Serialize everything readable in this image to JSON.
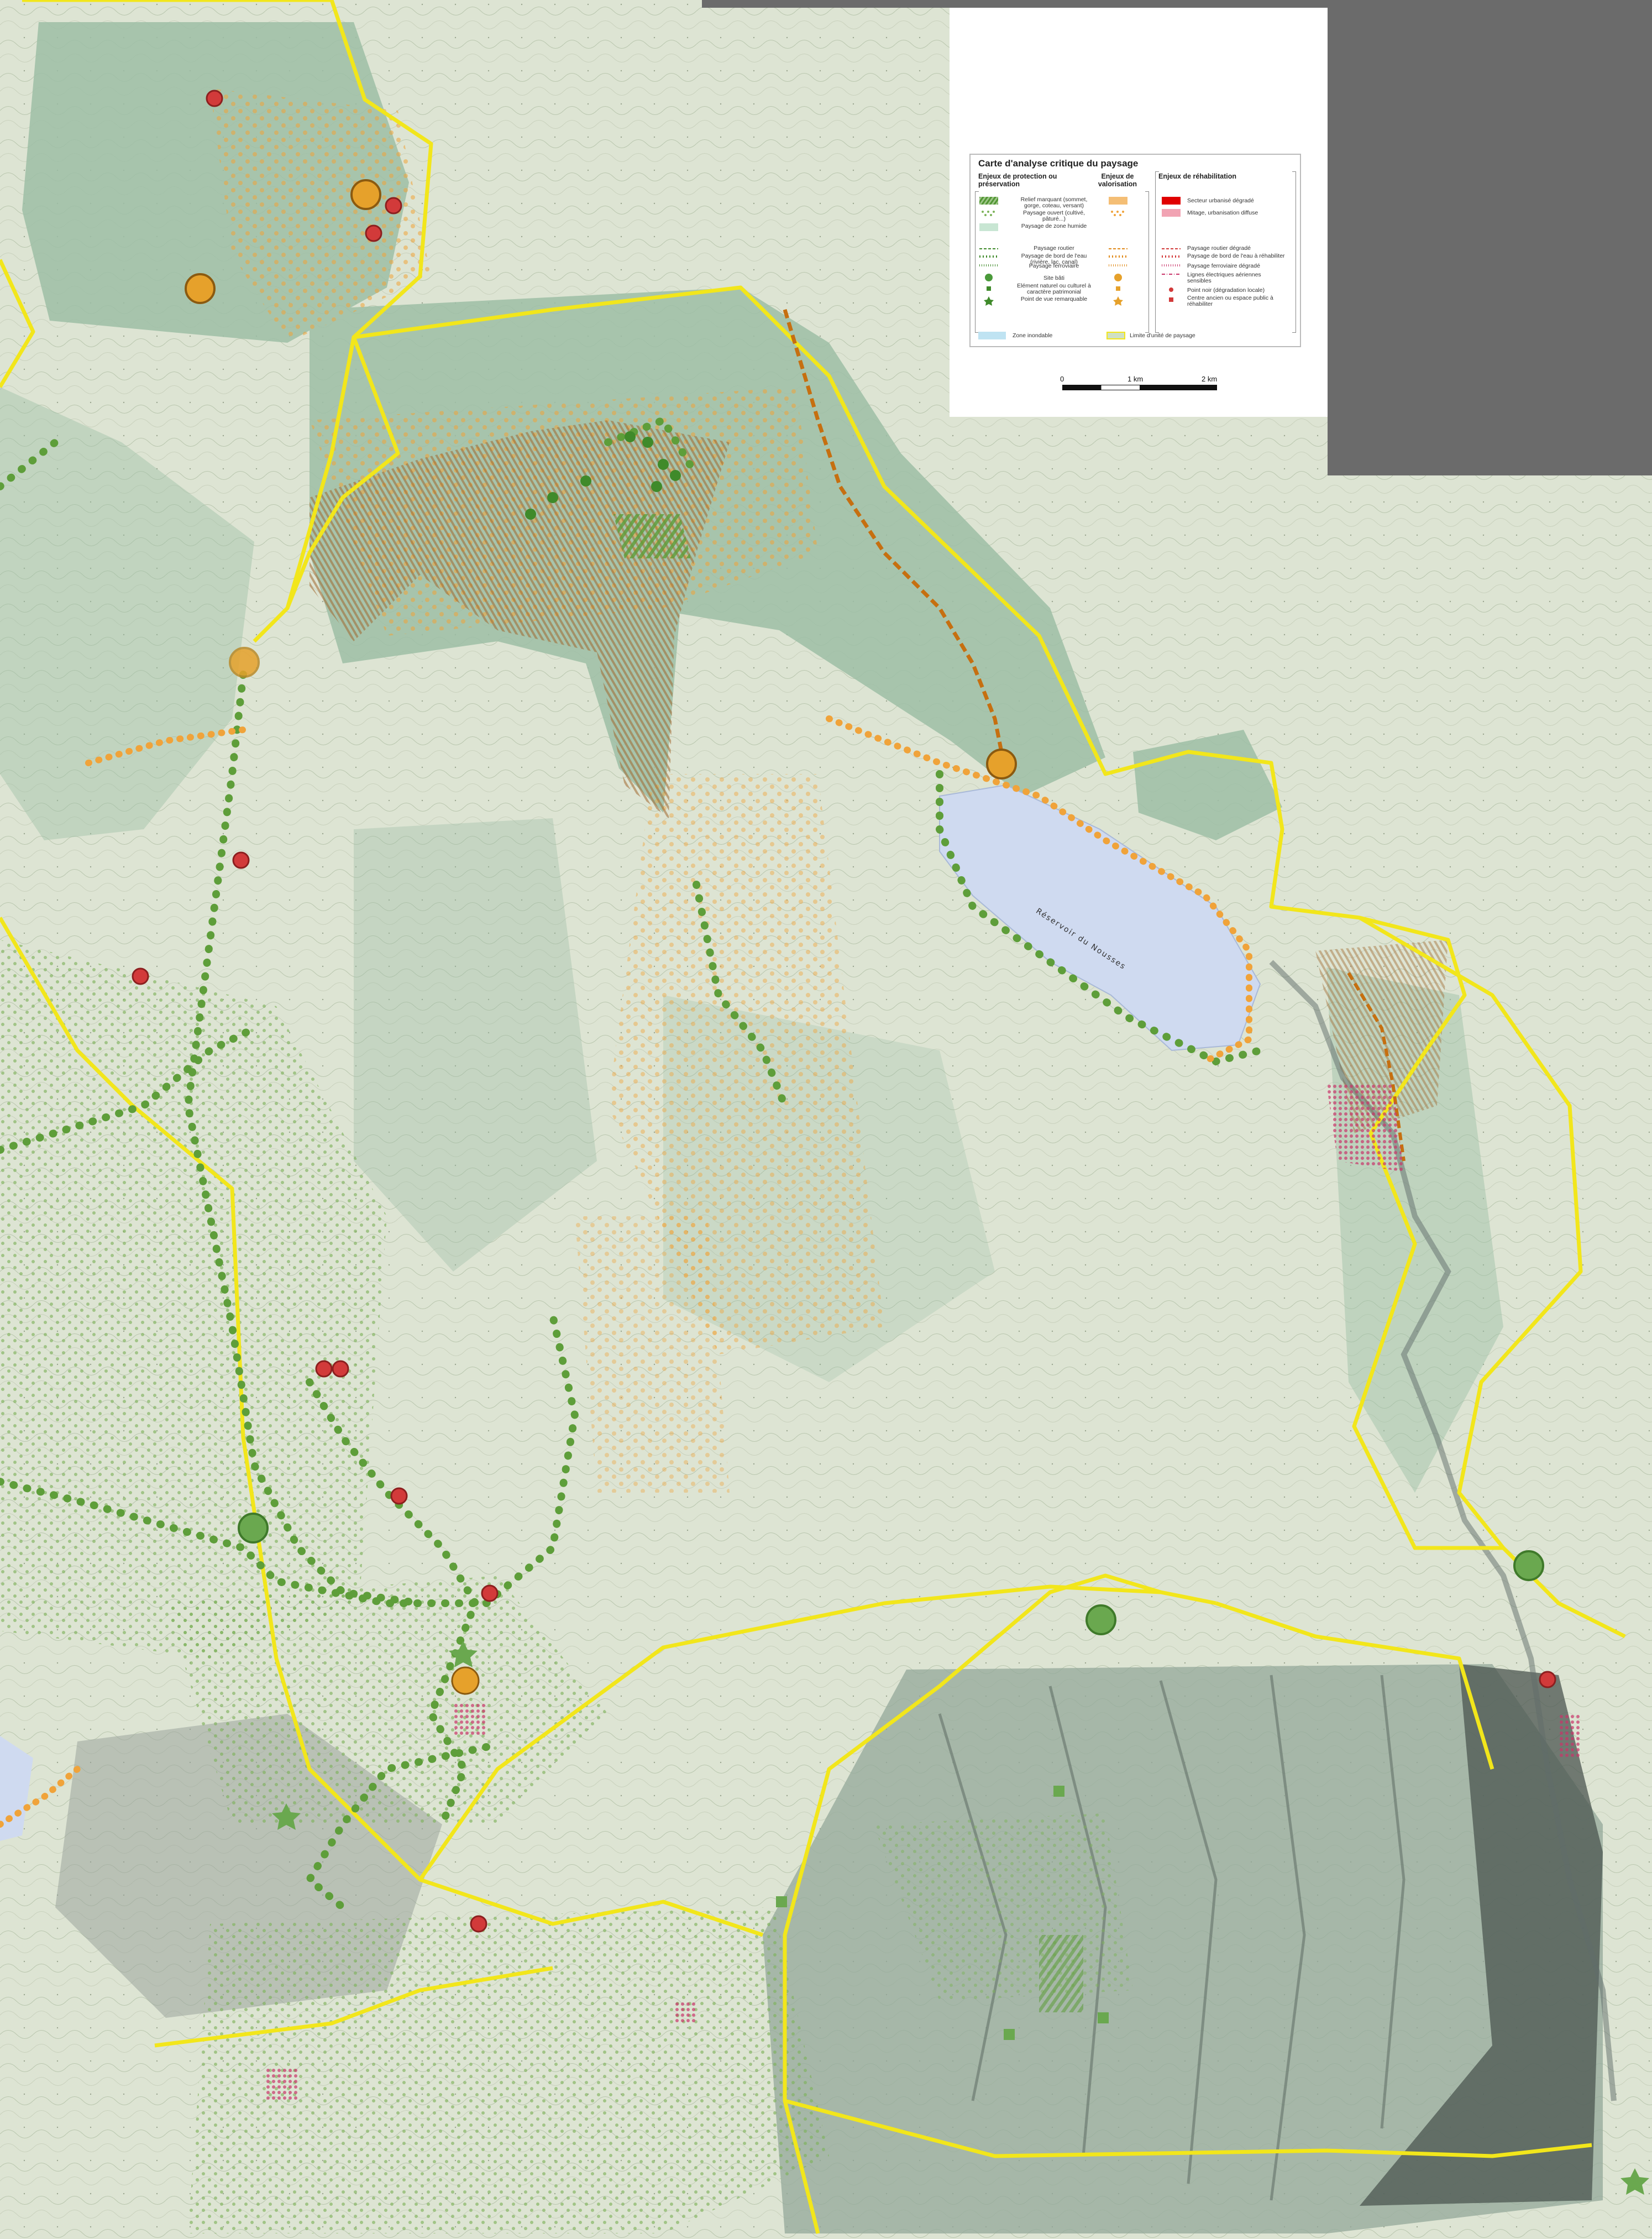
{
  "legend": {
    "title": "Carte d'analyse critique du paysage",
    "col_protection": "Enjeux de protection ou préservation",
    "col_valorisation": "Enjeux de valorisation",
    "col_rehabilitation": "Enjeux de réhabilitation",
    "items_protection": [
      "Relief marquant (sommet, gorge, coteau, versant)",
      "Paysage ouvert (cultivé, pâturé...)",
      "Paysage de zone humide",
      "Paysage routier",
      "Paysage de bord de l'eau (rivière, lac, canal)",
      "Paysage ferroviaire",
      "Site bâti",
      "Elément naturel ou culturel à caractère patrimonial",
      "Point de vue remarquable"
    ],
    "items_rehabilitation": [
      "Secteur urbanisé dégradé",
      "Mitage, urbanisation diffuse",
      "Paysage routier dégradé",
      "Paysage de bord de l'eau à réhabiliter",
      "Paysage ferroviaire dégradé",
      "Lignes électriques aériennes sensibles",
      "Point noir (dégradation locale)",
      "Centre ancien ou espace public à réhabiliter"
    ],
    "zone_inondable": "Zone inondable",
    "limite_unite": "Limite d'unité de paysage",
    "scale_labels": [
      "0",
      "1 km",
      "2 km"
    ]
  },
  "map": {
    "lake_label": "Réservoir du Nousses",
    "colors": {
      "forest": "#8fb49c",
      "paper": "#dfe5d6",
      "yellow_limit": "#f2e61b",
      "green_dot": "#6aa84f",
      "orange_dot": "#f0a33a",
      "red_point": "#d23a3a",
      "brown_relief": "#9b6a3c",
      "water": "#cfdaf0",
      "grey_panel": "#6b6b6b"
    }
  }
}
